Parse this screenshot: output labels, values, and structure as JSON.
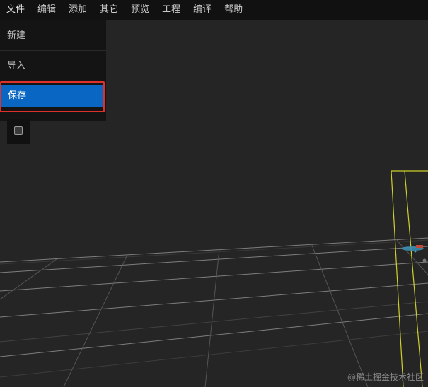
{
  "menubar": {
    "items": [
      {
        "label": "文件"
      },
      {
        "label": "编辑"
      },
      {
        "label": "添加"
      },
      {
        "label": "其它"
      },
      {
        "label": "预览"
      },
      {
        "label": "工程"
      },
      {
        "label": "编译"
      },
      {
        "label": "帮助"
      }
    ]
  },
  "file_menu": {
    "items": [
      {
        "label": "新建"
      },
      {
        "label": "导入"
      },
      {
        "label": "保存"
      }
    ],
    "highlighted_item": "保存"
  },
  "watermark": {
    "text": "@稀土掘金技术社区"
  },
  "colors": {
    "menubar_bg": "#111111",
    "viewport_bg": "#252525",
    "grid": "#9a9a9a",
    "selection_box": "#cfcf2a",
    "highlight": "#0966c2",
    "annotation": "#e0302b"
  }
}
